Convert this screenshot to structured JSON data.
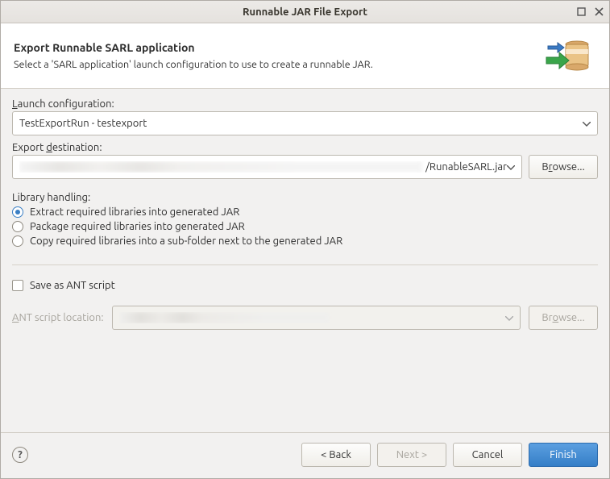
{
  "titlebar": {
    "title": "Runnable JAR File Export"
  },
  "banner": {
    "heading": "Export Runnable SARL application",
    "description": "Select a 'SARL application' launch configuration to use to create a runnable JAR."
  },
  "launch": {
    "label_pre": "L",
    "label_post": "aunch configuration:",
    "value": "TestExportRun - testexport"
  },
  "export": {
    "label_pre": "Export ",
    "label_mn": "d",
    "label_post": "estination:",
    "value": "/RunableSARL.jar",
    "browse_pre": "B",
    "browse_mn": "r",
    "browse_post": "owse..."
  },
  "library": {
    "label": "Library handling:",
    "options": [
      {
        "mn": "E",
        "post": "xtract required libraries into generated JAR",
        "checked": true
      },
      {
        "mn": "P",
        "post": "ackage required libraries into generated JAR",
        "checked": false
      },
      {
        "mn": "C",
        "post": "opy required libraries into a sub-folder next to the generated JAR",
        "checked": false
      }
    ]
  },
  "ant": {
    "save_mn": "S",
    "save_post": "ave as ANT script",
    "location_mn": "A",
    "location_post": "NT script location:",
    "browse_pre": "Br",
    "browse_mn": "o",
    "browse_post": "wse..."
  },
  "footer": {
    "back": "< Back",
    "next": "Next >",
    "cancel": "Cancel",
    "finish": "Finish"
  }
}
